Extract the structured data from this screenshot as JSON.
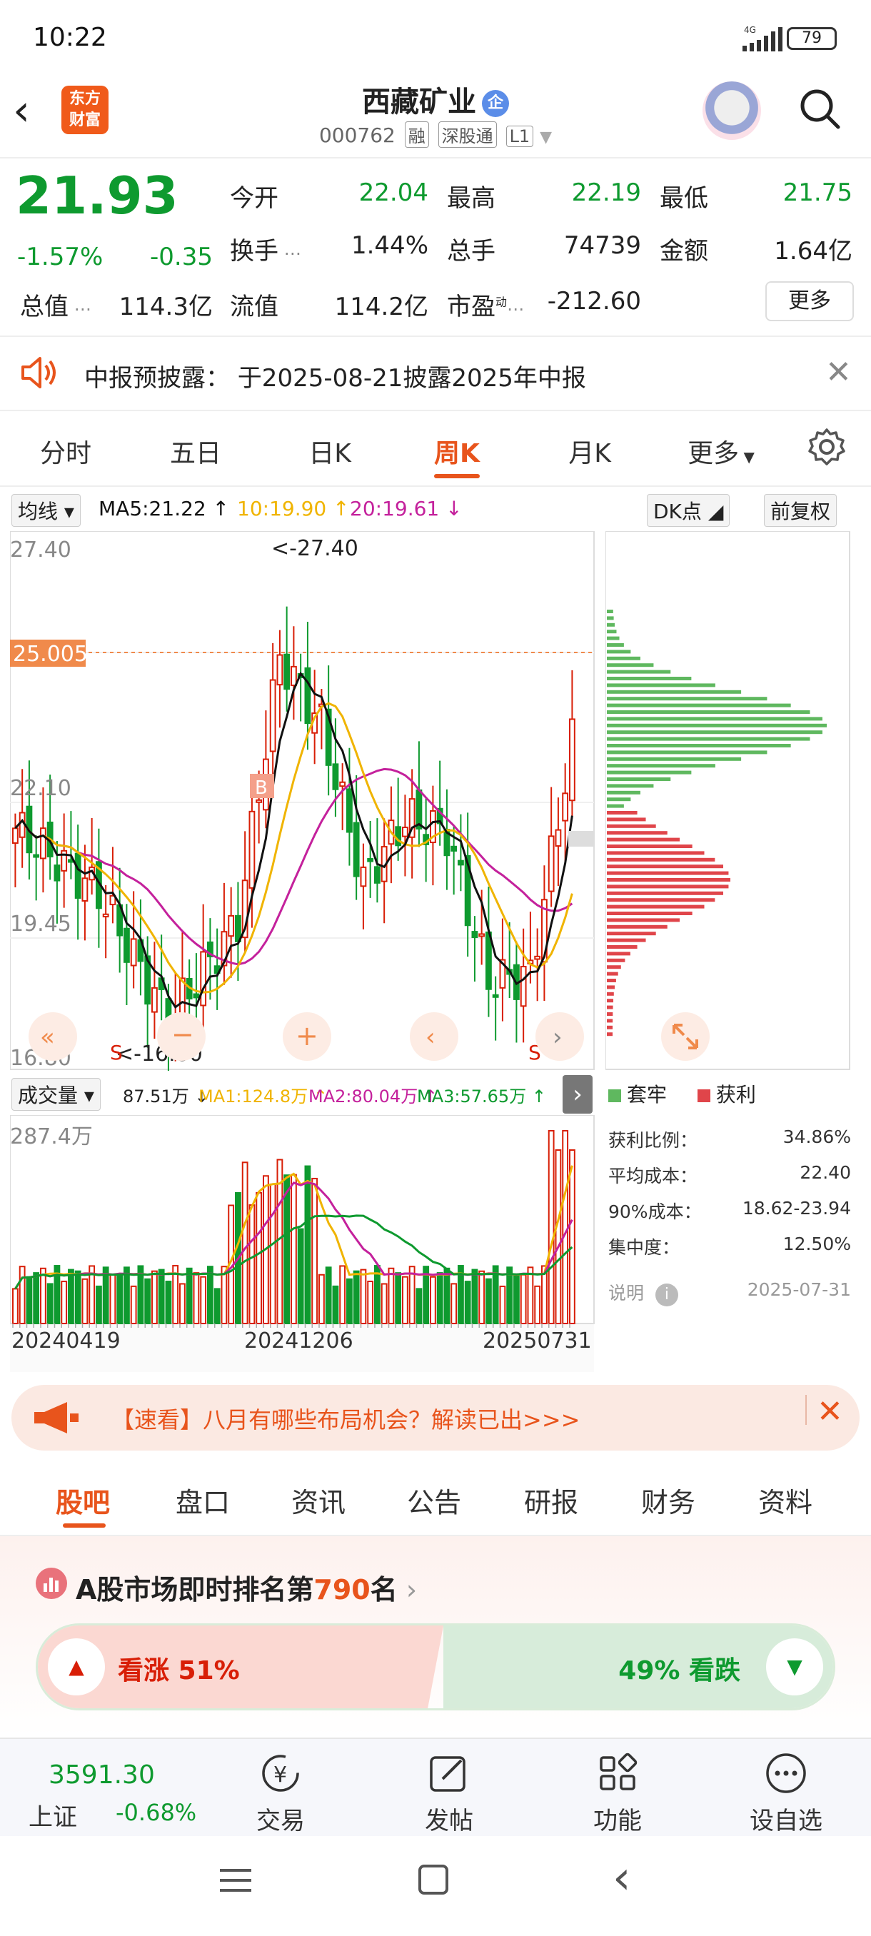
{
  "status_bar": {
    "time": "10:22",
    "network": "4G",
    "battery": "79"
  },
  "header": {
    "logo_line1": "东方",
    "logo_line2": "财富",
    "stock_name": "西藏矿业",
    "badge": "企",
    "stock_code": "000762",
    "tags": [
      "融",
      "深股通",
      "L1"
    ]
  },
  "quote": {
    "price": "21.93",
    "change_pct": "-1.57%",
    "change": "-0.35",
    "rows": [
      [
        {
          "l": "今开",
          "v": "22.04",
          "c": "green"
        },
        {
          "l": "最高",
          "v": "22.19",
          "c": "green"
        },
        {
          "l": "最低",
          "v": "21.75",
          "c": "green"
        }
      ],
      [
        {
          "l": "换手",
          "v": "1.44%",
          "c": "dark"
        },
        {
          "l": "总手",
          "v": "74739",
          "c": "dark"
        },
        {
          "l": "金额",
          "v": "1.64亿",
          "c": "dark"
        }
      ]
    ],
    "row3": [
      {
        "l": "总值",
        "v": "114.3亿"
      },
      {
        "l": "流值",
        "v": "114.2亿"
      },
      {
        "l": "市盈",
        "v": "-212.60"
      }
    ],
    "pe_sup": "动",
    "more": "更多"
  },
  "notice": {
    "text": "中报预披露：  于2025-08-21披露2025年中报"
  },
  "period_tabs": [
    "分时",
    "五日",
    "日K",
    "周K",
    "月K",
    "更多"
  ],
  "active_period": 3,
  "ma_bar": {
    "selector": "均线",
    "ma5": "MA5:21.22",
    "ma10": "10:19.90",
    "ma20": "20:19.61",
    "dk": "DK点",
    "fq": "前复权"
  },
  "kline": {
    "y_labels": [
      "27.40",
      "25.005",
      "22.10",
      "19.45",
      "16.80"
    ],
    "high_label": "<-27.40",
    "low_label": "<-16.80",
    "marker_b": "B",
    "marker_s": "S"
  },
  "volume": {
    "selector": "成交量",
    "vol": "87.51万",
    "ma1": "MA1:124.8万",
    "ma2": "MA2:80.04万",
    "ma3": "MA3:57.65万",
    "max_label": "287.4万",
    "dates": [
      "20240419",
      "20241206",
      "20250731"
    ]
  },
  "chip": {
    "legend_trapped": "套牢",
    "legend_profit": "获利",
    "items": [
      {
        "l": "获利比例：",
        "v": "34.86%"
      },
      {
        "l": "平均成本：",
        "v": "22.40"
      },
      {
        "l": "90%成本：",
        "v": "18.62-23.94"
      },
      {
        "l": "集中度：",
        "v": "12.50%"
      }
    ],
    "note_label": "说明",
    "date": "2025-07-31"
  },
  "banner": {
    "text": "【速看】八月有哪些布局机会？解读已出>>>"
  },
  "section_tabs": [
    "股吧",
    "盘口",
    "资讯",
    "公告",
    "研报",
    "财务",
    "资料"
  ],
  "ranking": {
    "prefix": "A股市场即时排名第",
    "rank": "790",
    "suffix": "名",
    "up_label": "看涨 51%",
    "down_label": "49% 看跌",
    "up_pct": 51
  },
  "bottom_nav": {
    "index_value": "3591.30",
    "index_name": "上证",
    "index_change": "-0.68%",
    "items": [
      "交易",
      "发帖",
      "功能",
      "设自选"
    ]
  },
  "colors": {
    "up": "#d81e06",
    "down": "#0e9a2f",
    "accent": "#e8541c",
    "ma5": "#111111",
    "ma10": "#f0b400",
    "ma20": "#c4219c"
  }
}
